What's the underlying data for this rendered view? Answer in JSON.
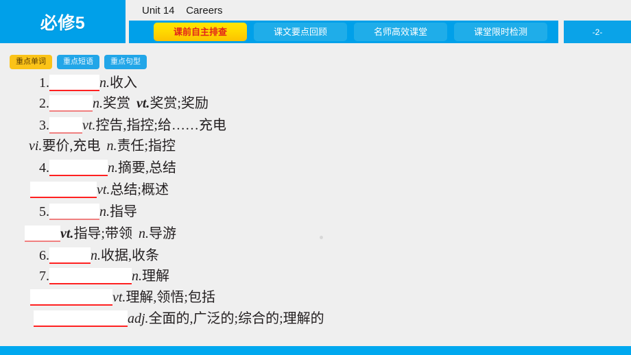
{
  "header": {
    "logo_label": "必修5",
    "unit_title": "Unit 14    Careers",
    "page_number": "-2-",
    "tabs": [
      {
        "label": "课前自主排查",
        "active": true
      },
      {
        "label": "课文要点回顾",
        "active": false
      },
      {
        "label": "名师高效课堂",
        "active": false
      },
      {
        "label": "课堂限时检测",
        "active": false
      }
    ]
  },
  "subtabs": [
    {
      "label": "重点单词",
      "active": true
    },
    {
      "label": "重点短语",
      "active": false
    },
    {
      "label": "重点句型",
      "active": false
    }
  ],
  "entries": [
    {
      "num": "1.",
      "pos1": "n.",
      "def1": "收入"
    },
    {
      "num": "2.",
      "pos1": "n.",
      "def1": "奖赏",
      "pos2": "vt.",
      "def2": "奖赏;奖励"
    },
    {
      "num": "3.",
      "pos1": "vt.",
      "def1": "控告,指控;给……充电",
      "pos2": "vi.",
      "def2": "要价,充电",
      "pos3": "n.",
      "def3": "责任;指控"
    },
    {
      "num": "4.",
      "pos1": "n.",
      "def1": "摘要,总结",
      "pos2": "vt.",
      "def2": "总结;概述"
    },
    {
      "num": "5.",
      "pos1": "n.",
      "def1": "指导",
      "pos2": "vt.",
      "def2": "指导;带领",
      "pos3": "n.",
      "def3": "导游"
    },
    {
      "num": "6.",
      "pos1": "n.",
      "def1": "收据,收条"
    },
    {
      "num": "7.",
      "pos1": "n.",
      "def1": "理解",
      "pos2": "vt.",
      "def2": "理解,领悟;包括",
      "pos3": "adj.",
      "def3": "全面的,广泛的;综合的;理解的"
    }
  ],
  "colors": {
    "brand_blue": "#00a0e9",
    "tab_blue": "#1fade9",
    "active_tab_yellow": "#ffd900",
    "active_tab_text_red": "#e2231a",
    "blank_underline_red": "#ff2020",
    "page_background": "#efefef"
  }
}
